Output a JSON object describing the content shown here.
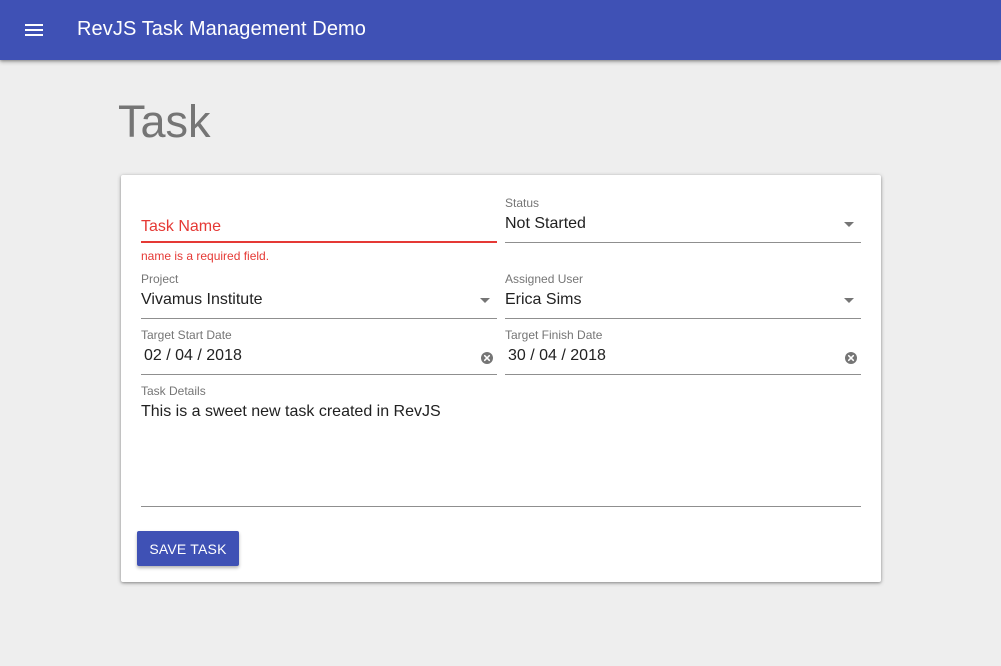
{
  "appbar": {
    "menu_icon": "menu-icon",
    "title": "RevJS Task Management Demo"
  },
  "page": {
    "title": "Task"
  },
  "form": {
    "task_name": {
      "label": "Task Name",
      "value": "",
      "error": "name is a required field."
    },
    "status": {
      "label": "Status",
      "value": "Not Started"
    },
    "project": {
      "label": "Project",
      "value": "Vivamus Institute"
    },
    "assigned_user": {
      "label": "Assigned User",
      "value": "Erica Sims"
    },
    "target_start_date": {
      "label": "Target Start Date",
      "value": "02 / 04 / 2018"
    },
    "target_finish_date": {
      "label": "Target Finish Date",
      "value": "30 / 04 / 2018"
    },
    "task_details": {
      "label": "Task Details",
      "value": "This is a sweet new task created in RevJS"
    },
    "save_label": "SAVE TASK"
  },
  "colors": {
    "primary": "#3f51b5",
    "error": "#e53935",
    "background": "#eeeeee"
  }
}
